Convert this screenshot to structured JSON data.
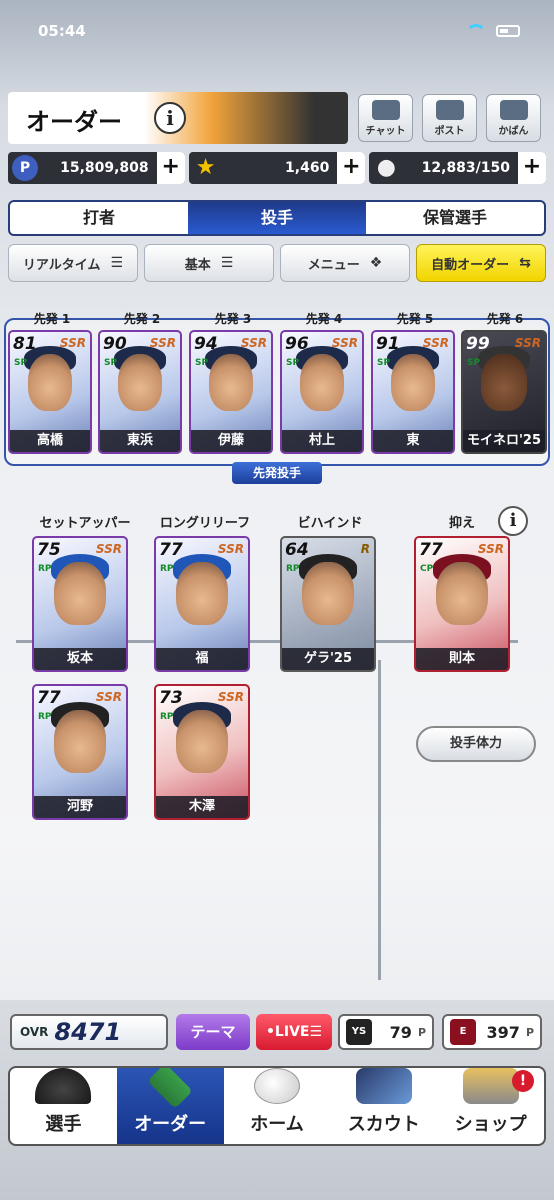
{
  "status": {
    "time": "05:44"
  },
  "header": {
    "title": "オーダー",
    "info": "i"
  },
  "top_buttons": [
    {
      "label": "チャット",
      "icon": "chat-icon"
    },
    {
      "label": "ポスト",
      "icon": "mail-icon"
    },
    {
      "label": "かばん",
      "icon": "bag-icon"
    }
  ],
  "currencies": [
    {
      "icon_letter": "P",
      "value": "15,809,808",
      "plus": "+"
    },
    {
      "icon_letter": "★",
      "value": "1,460",
      "plus": "+"
    },
    {
      "icon_letter": "●",
      "value": "12,883/150",
      "plus": "+"
    }
  ],
  "tabs": [
    "打者",
    "投手",
    "保管選手"
  ],
  "filters": [
    {
      "label": "リアルタイム",
      "glyph": "☰"
    },
    {
      "label": "基本",
      "glyph": "☰"
    },
    {
      "label": "メニュー",
      "glyph": "❖"
    },
    {
      "label": "自動オーダー",
      "glyph": "⇆"
    }
  ],
  "starter_caption": "先発投手",
  "starters": [
    {
      "slot": "先発 1",
      "ovr": "81",
      "pos": "SP",
      "rarity": "SSR",
      "name": "高橋"
    },
    {
      "slot": "先発 2",
      "ovr": "90",
      "pos": "SP",
      "rarity": "SSR",
      "name": "東浜"
    },
    {
      "slot": "先発 3",
      "ovr": "94",
      "pos": "SP",
      "rarity": "SSR",
      "name": "伊藤"
    },
    {
      "slot": "先発 4",
      "ovr": "96",
      "pos": "SP",
      "rarity": "SSR",
      "name": "村上"
    },
    {
      "slot": "先発 5",
      "ovr": "91",
      "pos": "SP",
      "rarity": "SSR",
      "name": "東"
    },
    {
      "slot": "先発 6",
      "ovr": "99",
      "pos": "SP",
      "rarity": "SSR",
      "name": "モイネロ'25"
    }
  ],
  "relief_labels": {
    "setup": "セットアッパー",
    "long": "ロングリリーフ",
    "behind": "ビハインド",
    "closer": "抑え"
  },
  "relievers": {
    "setup1": {
      "ovr": "75",
      "pos": "RP",
      "rarity": "SSR",
      "name": "坂本"
    },
    "setup2": {
      "ovr": "77",
      "pos": "RP",
      "rarity": "SSR",
      "name": "河野"
    },
    "long1": {
      "ovr": "77",
      "pos": "RP",
      "rarity": "SSR",
      "name": "福"
    },
    "long2": {
      "ovr": "73",
      "pos": "RP",
      "rarity": "SSR",
      "name": "木澤"
    },
    "behind": {
      "ovr": "64",
      "pos": "RP",
      "rarity": "R",
      "name": "ゲラ'25"
    },
    "closer": {
      "ovr": "77",
      "pos": "CP",
      "rarity": "SSR",
      "name": "則本"
    }
  },
  "stamina_button": "投手体力",
  "footer": {
    "ovr_label": "OVR",
    "ovr_value": "8471",
    "theme": "テーマ",
    "live": "•LIVE☰",
    "points": [
      {
        "logo": "YS",
        "value": "79",
        "unit": "P"
      },
      {
        "logo": "E",
        "value": "397",
        "unit": "P"
      }
    ]
  },
  "nav": [
    "選手",
    "オーダー",
    "ホーム",
    "スカウト",
    "ショップ"
  ],
  "nav_badge": "!",
  "colors": {
    "accent": "#2a5ad0",
    "live": "#d81a2f",
    "theme": "#7d3bc9",
    "auto": "#f2d400"
  }
}
